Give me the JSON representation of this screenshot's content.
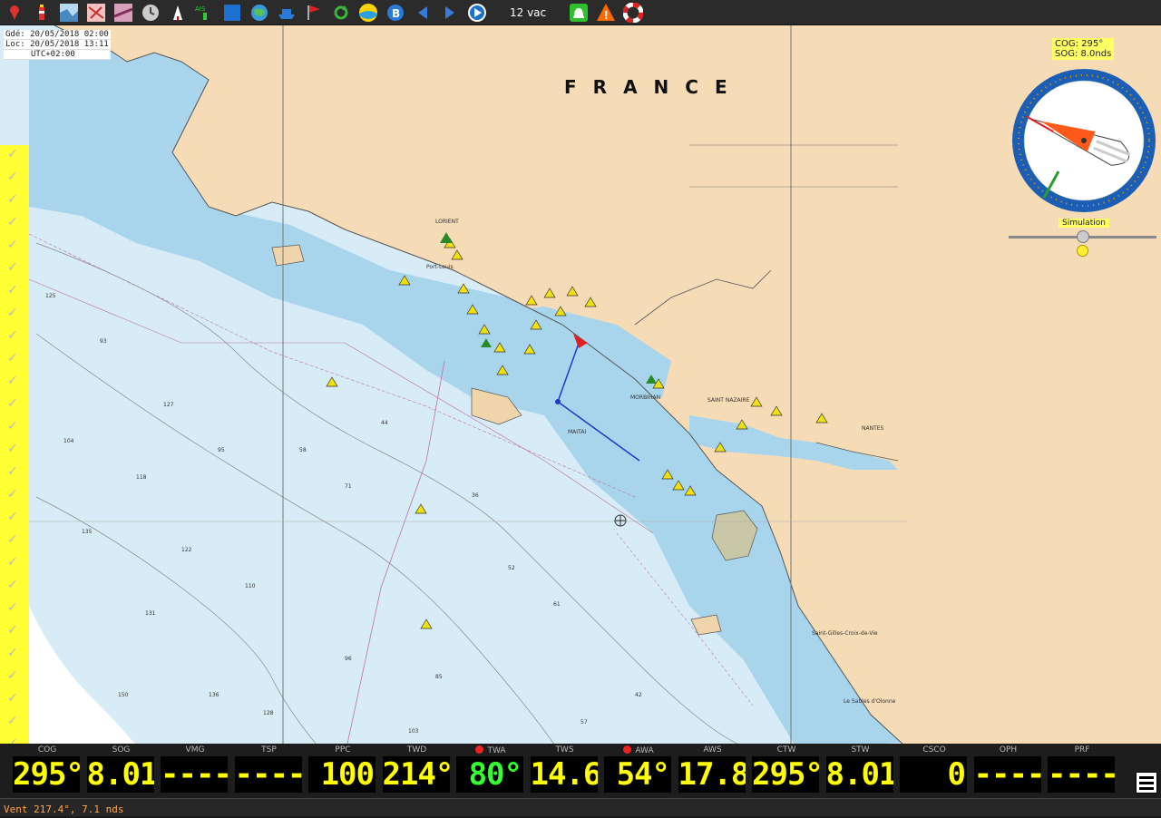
{
  "toolbar": {
    "tide_label": "12 vac",
    "icons": [
      "pin-icon",
      "lighthouse-icon",
      "chart-icon",
      "chart2-icon",
      "chart3-icon",
      "clock-icon",
      "buoy-icon",
      "ais-icon",
      "layer-icon",
      "globe-icon",
      "ship-icon",
      "flag-icon",
      "refresh-icon",
      "tide-globe-icon",
      "b-icon",
      "prev-icon",
      "next-icon",
      "play-icon",
      "bell-icon",
      "warning-icon",
      "lifebuoy-icon"
    ]
  },
  "infobox": {
    "line1": "Gdé: 20/05/2018 02:00",
    "line2": "Loc: 20/05/2018 13:11",
    "line3": "UTC+02:00"
  },
  "map": {
    "country_label": "FRANCE",
    "colors": {
      "land": "#f5dcb7",
      "shallow": "#a8d4ec",
      "deep": "#d7ecf6",
      "coast": "#555555"
    },
    "town_labels": [
      "LORIENT",
      "MORBIHAN",
      "SAINT NAZAIRE",
      "NANTES",
      "MAITAI",
      "Le Sables d'Olonne",
      "Saint-Gilles-Croix-de-Vie",
      "Port-Louis"
    ]
  },
  "compass": {
    "cog": "COG: 295°",
    "sog": "SOG: 8.0nds",
    "simulation_label": "Simulation",
    "colors": {
      "ring": "#1c5eb4",
      "bezel": "#e8a000"
    }
  },
  "instruments": [
    {
      "label": "COG",
      "value": "295°",
      "color": "#ffff00"
    },
    {
      "label": "SOG",
      "value": "8.01",
      "color": "#ffff00"
    },
    {
      "label": "VMG",
      "value": "----",
      "color": "#ffff00"
    },
    {
      "label": "TSP",
      "value": "----",
      "color": "#ffff00"
    },
    {
      "label": "PPC",
      "value": "100",
      "color": "#ffff00"
    },
    {
      "label": "TWD",
      "value": "214°",
      "color": "#ffff00"
    },
    {
      "label": "TWA",
      "value": "80°",
      "color": "#33ff33",
      "alarm": true
    },
    {
      "label": "TWS",
      "value": "14.6",
      "color": "#ffff00"
    },
    {
      "label": "AWA",
      "value": "54°",
      "color": "#ffff00",
      "alarm": true
    },
    {
      "label": "AWS",
      "value": "17.8",
      "color": "#ffff00"
    },
    {
      "label": "CTW",
      "value": "295°",
      "color": "#ffff00"
    },
    {
      "label": "STW",
      "value": "8.01",
      "color": "#ffff00"
    },
    {
      "label": "CSCO",
      "value": "0",
      "color": "#ffff00"
    },
    {
      "label": "OPH",
      "value": "----",
      "color": "#ffff00"
    },
    {
      "label": "PRF",
      "value": "----",
      "color": "#ffff00"
    }
  ],
  "status": {
    "text": "Vent 217.4°, 7.1 nds"
  }
}
